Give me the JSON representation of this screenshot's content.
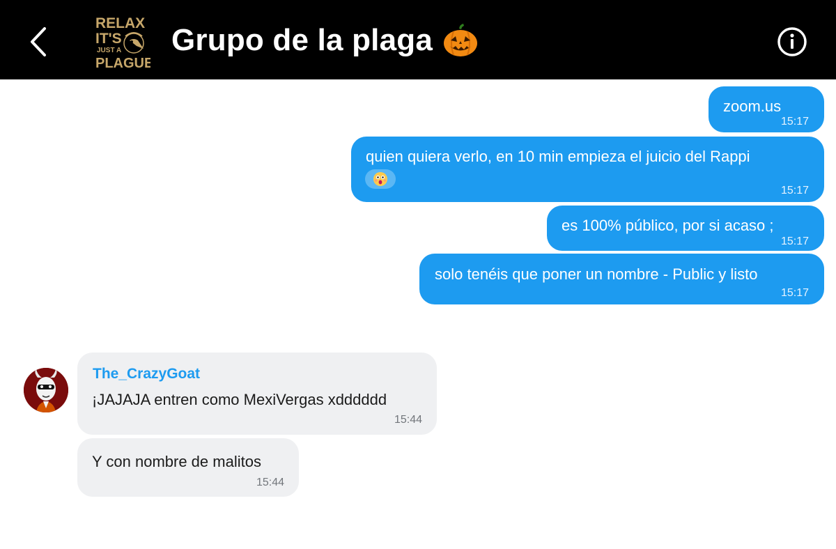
{
  "header": {
    "title": "Grupo de la plaga",
    "logo_text": [
      "RELAX",
      "IT'S",
      "JUST A",
      "PLAGUE"
    ],
    "title_emoji": "jack-o-lantern-icon"
  },
  "colors": {
    "header_bg": "#000000",
    "outgoing_bubble": "#1d9bf0",
    "incoming_bubble": "#eff0f2",
    "sender_name": "#1d9bf0",
    "logo_gold": "#c7a76a"
  },
  "messages": [
    {
      "direction": "out",
      "text": "zoom.us",
      "time": "15:17"
    },
    {
      "direction": "out",
      "text": "quien quiera verlo, en 10 min empieza el juicio del Rappi",
      "emoji": "astonished-face-icon",
      "time": "15:17"
    },
    {
      "direction": "out",
      "text": "es 100% público, por si acaso ;",
      "time": "15:17"
    },
    {
      "direction": "out",
      "text": "solo tenéis que poner un nombre - Public y listo",
      "time": "15:17"
    },
    {
      "direction": "in",
      "sender": "The_CrazyGoat",
      "text": "¡JAJAJA entren como MexiVergas xdddddd",
      "time": "15:44"
    },
    {
      "direction": "in",
      "text": "Y con nombre de malitos",
      "time": "15:44"
    }
  ]
}
